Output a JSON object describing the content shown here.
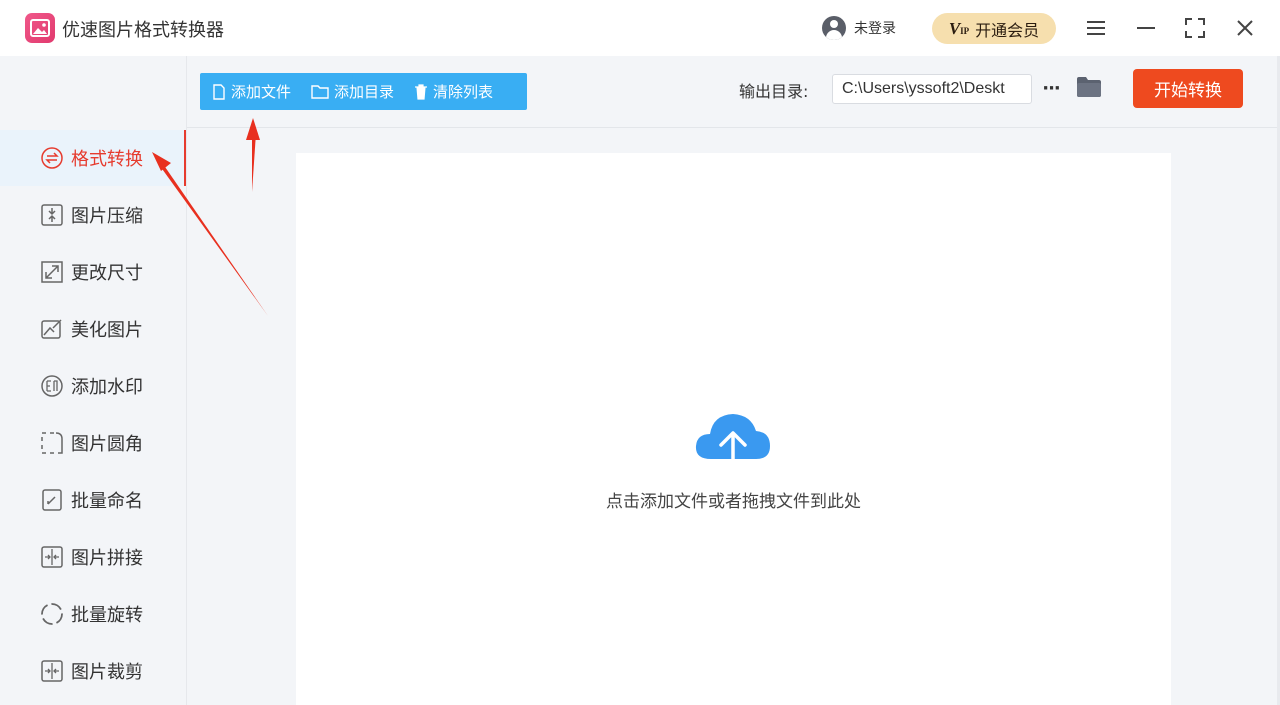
{
  "app": {
    "title": "优速图片格式转换器"
  },
  "header": {
    "login_text": "未登录",
    "vip_badge": "V",
    "vip_badge_sub": "IP",
    "vip_label": "开通会员"
  },
  "toolbar": {
    "add_file": "添加文件",
    "add_folder": "添加目录",
    "clear_list": "清除列表",
    "output_label": "输出目录:",
    "output_path": "C:\\Users\\yssoft2\\Deskt",
    "more": "···",
    "start": "开始转换"
  },
  "sidebar": {
    "items": [
      {
        "label": "格式转换",
        "icon": "format-convert-icon",
        "active": true
      },
      {
        "label": "图片压缩",
        "icon": "compress-icon"
      },
      {
        "label": "更改尺寸",
        "icon": "resize-icon"
      },
      {
        "label": "美化图片",
        "icon": "beautify-icon"
      },
      {
        "label": "添加水印",
        "icon": "watermark-icon"
      },
      {
        "label": "图片圆角",
        "icon": "round-corner-icon"
      },
      {
        "label": "批量命名",
        "icon": "rename-icon"
      },
      {
        "label": "图片拼接",
        "icon": "stitch-icon"
      },
      {
        "label": "批量旋转",
        "icon": "rotate-icon"
      },
      {
        "label": "图片裁剪",
        "icon": "crop-icon"
      }
    ]
  },
  "dropzone": {
    "hint": "点击添加文件或者拖拽文件到此处"
  },
  "colors": {
    "accent_blue": "#39aef3",
    "start_red": "#ee4a1f",
    "active_red": "#e63b2e",
    "vip_gold": "#f6dfae",
    "cloud_blue": "#3a99f0",
    "annotation_red": "#e8301f"
  }
}
